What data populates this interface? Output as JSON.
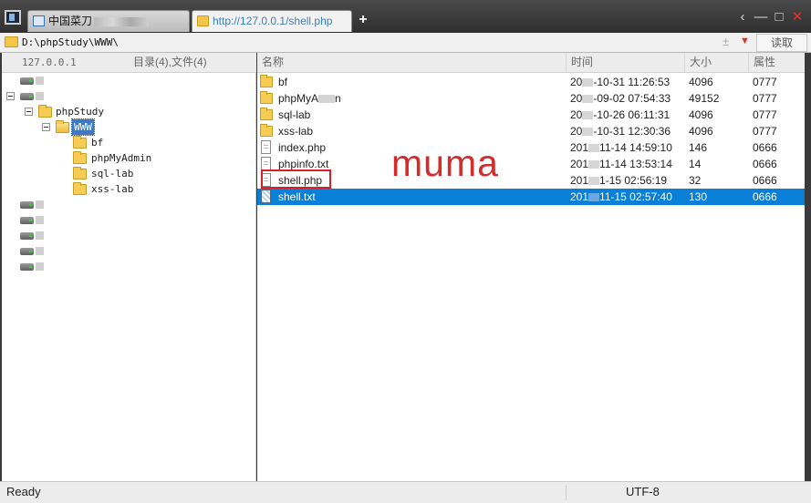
{
  "window": {
    "tabs": [
      {
        "label": "中国菜刀",
        "active": false
      },
      {
        "label": "http://127.0.0.1/shell.php",
        "active": true
      }
    ],
    "new_tab": "+",
    "controls": {
      "back": "‹",
      "minimize": "—",
      "maximize": "□",
      "close": "✕"
    }
  },
  "address": {
    "path": "D:\\phpStudy\\WWW\\",
    "plus": "±",
    "dropdown": "▼",
    "read_label": "读取"
  },
  "left_pane": {
    "host": "127.0.0.1",
    "summary": "目录(4),文件(4)",
    "tree": {
      "folders": [
        "phpStudy",
        "WWW",
        "bf",
        "phpMyAdmin",
        "sql-lab",
        "xss-lab"
      ]
    }
  },
  "columns": {
    "name": "名称",
    "time": "时间",
    "size": "大小",
    "attr": "属性"
  },
  "files": [
    {
      "type": "folder",
      "name": "bf",
      "time_a": "20",
      "time_b": "-10-31 11:26:53",
      "size": "4096",
      "attr": "0777"
    },
    {
      "type": "folder",
      "name_a": "phpMyA",
      "name_b": "n",
      "time_a": "20",
      "time_b": "-09-02 07:54:33",
      "size": "49152",
      "attr": "0777"
    },
    {
      "type": "folder",
      "name": "sql-lab",
      "time_a": "20",
      "time_b": "-10-26 06:11:31",
      "size": "4096",
      "attr": "0777"
    },
    {
      "type": "folder",
      "name": "xss-lab",
      "time_a": "20",
      "time_b": "-10-31 12:30:36",
      "size": "4096",
      "attr": "0777"
    },
    {
      "type": "doc",
      "name": "index.php",
      "time_a": "201",
      "time_b": "11-14 14:59:10",
      "size": "146",
      "attr": "0666"
    },
    {
      "type": "doc",
      "name": "phpinfo.txt",
      "time_a": "201",
      "time_b": "11-14 13:53:14",
      "size": "14",
      "attr": "0666"
    },
    {
      "type": "doc",
      "name": "shell.php",
      "time_a": "201",
      "time_b": "1-15 02:56:19",
      "size": "32",
      "attr": "0666"
    },
    {
      "type": "txt",
      "name": "shell.txt",
      "time_a": "201",
      "time_b": "11-15 02:57:40",
      "size": "130",
      "attr": "0666",
      "selected": true
    }
  ],
  "annotation": "muma",
  "status": {
    "left": "Ready",
    "encoding": "UTF-8"
  },
  "colors": {
    "selection": "#0a7fd8",
    "highlight": "#d9202a",
    "folder": "#f6cc55"
  }
}
